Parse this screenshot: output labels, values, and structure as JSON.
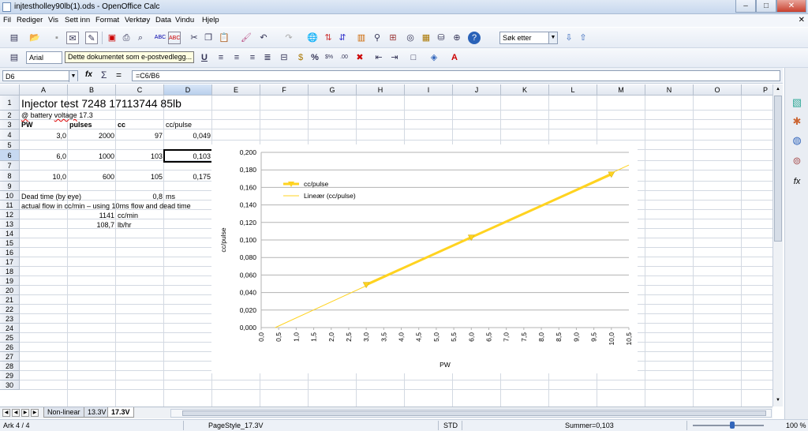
{
  "window": {
    "title": "injtestholley90lb(1).ods - OpenOffice Calc",
    "min": "–",
    "max": "□",
    "close": "✕"
  },
  "menu": [
    "Fil",
    "Rediger",
    "Vis",
    "Sett inn",
    "Format",
    "Verktøy",
    "Data",
    "Vindu",
    "Hjelp"
  ],
  "toolbar": {
    "search_placeholder": "Søk etter",
    "font_name": "Arial",
    "tooltip": "Dette dokumentet som e-postvedlegg..."
  },
  "formula_bar": {
    "cell_ref": "D6",
    "formula": "=C6/B6",
    "fx": "fx",
    "sum": "Σ",
    "eq": "="
  },
  "columns": [
    "A",
    "B",
    "C",
    "D",
    "E",
    "F",
    "G",
    "H",
    "I",
    "J",
    "K",
    "L",
    "M",
    "N",
    "O",
    "P"
  ],
  "rows": [
    "1",
    "2",
    "3",
    "4",
    "5",
    "6",
    "7",
    "8",
    "9",
    "10",
    "11",
    "12",
    "13",
    "14",
    "15",
    "16",
    "17",
    "18",
    "19",
    "20",
    "21",
    "22",
    "23",
    "24",
    "25",
    "26",
    "27",
    "28",
    "29",
    "30"
  ],
  "cells": {
    "a1": "Injector test 7248 17113744  85lb",
    "a2": "@ battery voltage 17.3",
    "a3": "PW",
    "b3": "pulses",
    "c3": "cc",
    "d3": "cc/pulse",
    "a4": "3,0",
    "b4": "2000",
    "c4": "97",
    "d4": "0,049",
    "a6": "6,0",
    "b6": "1000",
    "c6": "103",
    "d6": "0,103",
    "a8": "10,0",
    "b8": "600",
    "c8": "105",
    "d8": "0,175",
    "a10": "Dead time (by eye)",
    "c10": "0,8",
    "d10": "ms",
    "a11": "actual flow in cc/min – using 10ms flow and dead time",
    "b12": "1141",
    "c12": "cc/min",
    "b13": "108,7",
    "c13": "lb/hr"
  },
  "chart_data": {
    "type": "scatter",
    "xlabel": "PW",
    "ylabel": "cc/pulse",
    "xlim": [
      0,
      10.5
    ],
    "ylim": [
      0,
      0.2
    ],
    "x_ticks": [
      "0,0",
      "0,5",
      "1,0",
      "1,5",
      "2,0",
      "2,5",
      "3,0",
      "3,5",
      "4,0",
      "4,5",
      "5,0",
      "5,5",
      "6,0",
      "6,5",
      "7,0",
      "7,5",
      "8,0",
      "8,5",
      "9,0",
      "9,5",
      "10,0",
      "10,5"
    ],
    "y_ticks": [
      "0,000",
      "0,020",
      "0,040",
      "0,060",
      "0,080",
      "0,100",
      "0,120",
      "0,140",
      "0,160",
      "0,180",
      "0,200"
    ],
    "series": [
      {
        "name": "cc/pulse",
        "x": [
          3,
          6,
          10
        ],
        "y": [
          0.049,
          0.103,
          0.175
        ],
        "color": "#ffd320",
        "marker": "triangle-down",
        "line": true
      }
    ],
    "trendline": {
      "name": "Lineær (cc/pulse)",
      "x": [
        0.4,
        10.5
      ],
      "y": [
        0.0,
        0.1855
      ],
      "color": "#ffd320"
    },
    "legend": "top-left inside",
    "grid": "horizontal"
  },
  "sheets": [
    "Non-linear",
    "13.3V",
    "17.3V"
  ],
  "active_sheet": "17.3V",
  "status": {
    "sheet": "Ark 4 / 4",
    "pagestyle": "PageStyle_17.3V",
    "mode": "STD",
    "sum": "Summer=0,103",
    "zoom": "100 %"
  }
}
